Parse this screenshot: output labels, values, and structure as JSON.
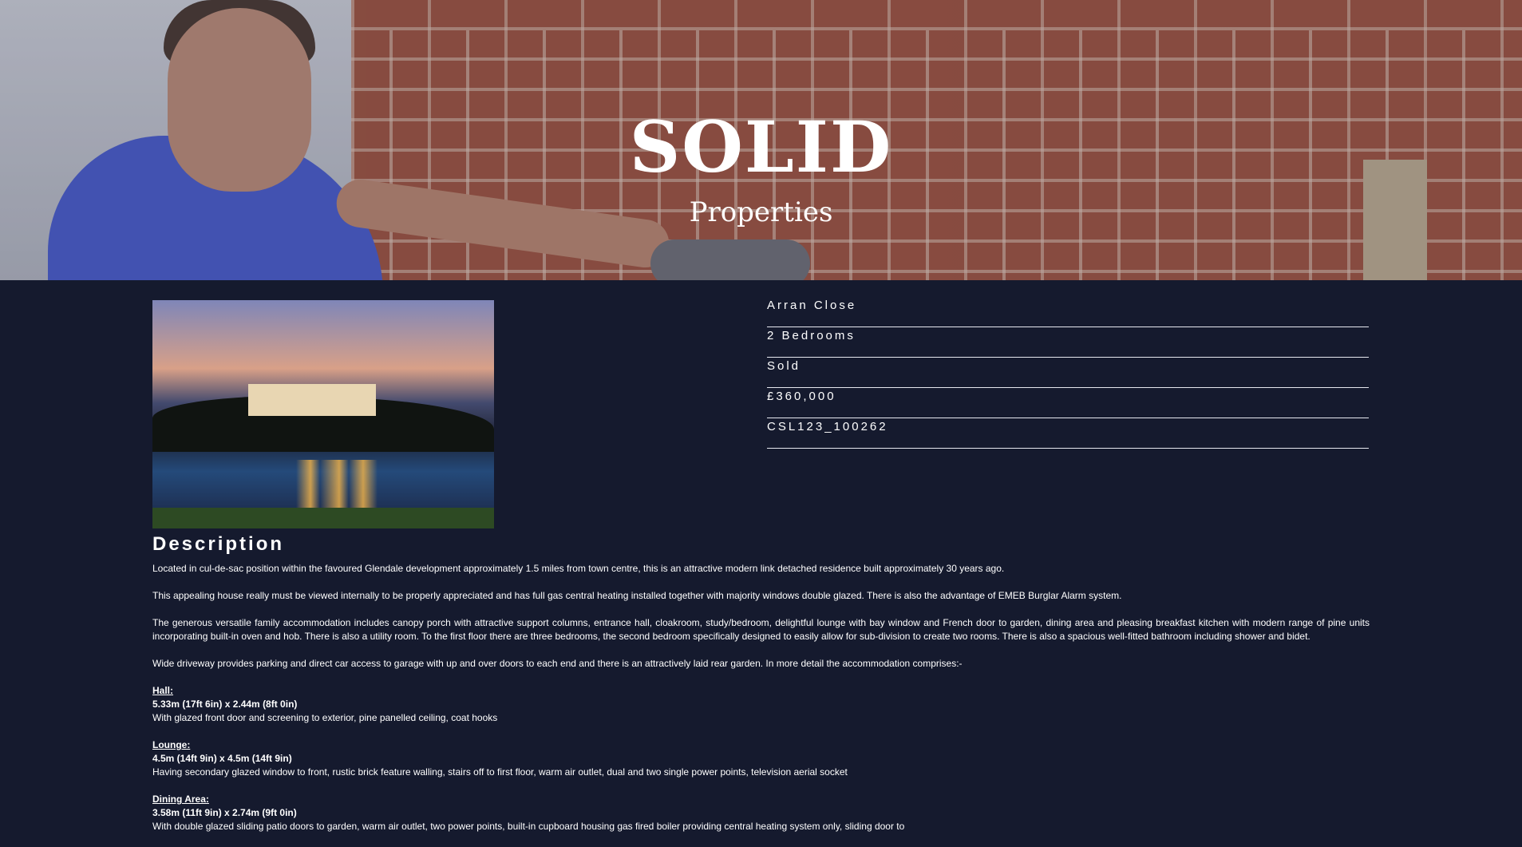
{
  "hero": {
    "title": "SOLID",
    "subtitle": "Properties"
  },
  "property": {
    "fields": [
      "Arran Close",
      "2 Bedrooms",
      "Sold",
      "£360,000",
      "CSL123_100262"
    ]
  },
  "description": {
    "heading": "Description",
    "paragraphs": [
      "Located in cul-de-sac position within the favoured Glendale development approximately 1.5 miles from town centre, this is an attractive modern link detached residence built approximately 30 years ago.",
      "This appealing house really must be viewed internally to be properly appreciated and has full gas central heating installed together with majority windows double glazed. There is also the advantage of EMEB Burglar Alarm system.",
      "The generous versatile family accommodation includes canopy porch with attractive support columns, entrance hall, cloakroom, study/bedroom, delightful lounge with bay window and French door to garden, dining area and pleasing breakfast kitchen with modern range of pine units incorporating built-in oven and hob. There is also a utility room. To the first floor there are three bedrooms, the second bedroom specifically designed to easily allow for sub-division to create two rooms. There is also a spacious well-fitted bathroom including shower and bidet.",
      "Wide driveway provides parking and direct car access to garage with up and over doors to each end and there is an attractively laid rear garden. In more detail the accommodation comprises:-"
    ],
    "rooms": [
      {
        "name": "Hall:",
        "size": "5.33m (17ft 6in) x 2.44m (8ft 0in)",
        "text": "With glazed front door and screening to exterior, pine panelled ceiling, coat hooks"
      },
      {
        "name": "Lounge:",
        "size": "4.5m (14ft 9in) x 4.5m (14ft 9in)",
        "text": "Having secondary glazed window to front, rustic brick feature walling, stairs off to first floor, warm air outlet, dual and two single power points, television aerial socket"
      },
      {
        "name": "Dining Area:",
        "size": "3.58m (11ft 9in) x 2.74m (9ft 0in)",
        "text": "With double glazed sliding patio doors to garden, warm air outlet, two power points, built-in cupboard housing gas fired boiler providing central heating system only, sliding door to"
      }
    ]
  }
}
